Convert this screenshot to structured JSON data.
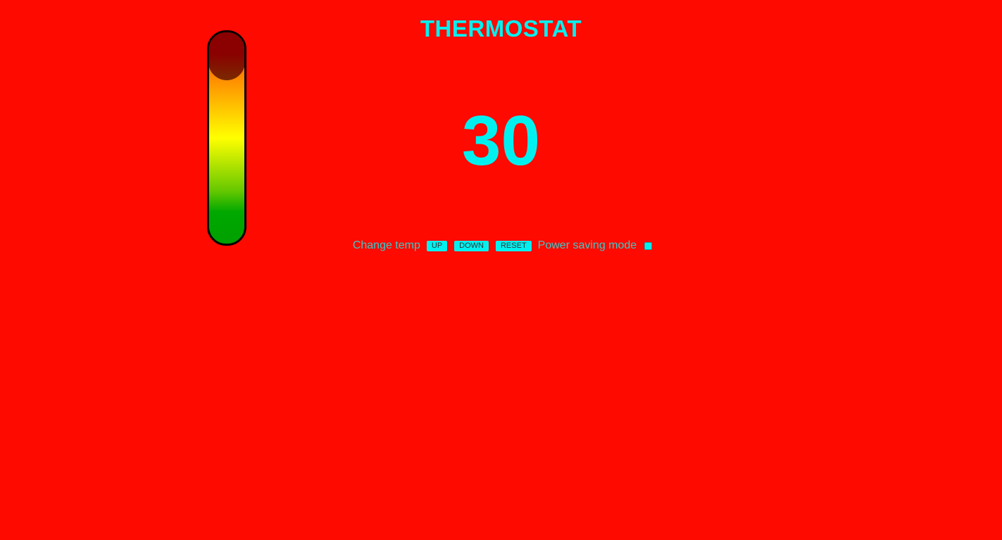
{
  "title": "THERMOSTAT",
  "temperature": {
    "value": "30",
    "fill_level": 0.23
  },
  "controls": {
    "change_label": "Change temp",
    "up_label": "UP",
    "down_label": "DOWN",
    "reset_label": "RESET",
    "power_saving_label": "Power saving mode",
    "power_saving_checked": false
  },
  "colors": {
    "background": "#ff0a00",
    "accent": "#00f0f0",
    "label_text": "#3cc8c8",
    "indicator": "#8b0000"
  }
}
